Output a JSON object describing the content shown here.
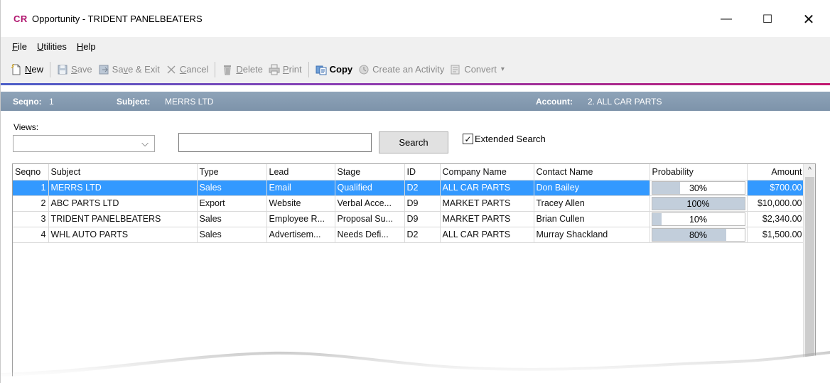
{
  "window": {
    "app_logo": "CR",
    "title": "Opportunity - TRIDENT PANELBEATERS",
    "minimize_glyph": "—",
    "maximize_glyph": "☐",
    "close_glyph": "✕"
  },
  "menu": [
    {
      "u": "F",
      "rest": "ile"
    },
    {
      "u": "U",
      "rest": "tilities"
    },
    {
      "u": "H",
      "rest": "elp"
    }
  ],
  "toolbar": {
    "new": {
      "u": "N",
      "rest": "ew",
      "icon": "new-document-icon"
    },
    "save": {
      "pre": "",
      "u": "S",
      "rest": "ave",
      "icon": "save-icon"
    },
    "save_exit": {
      "pre": "Sa",
      "u": "v",
      "rest": "e & Exit",
      "icon": "save-exit-icon"
    },
    "cancel": {
      "u": "C",
      "rest": "ancel",
      "icon": "cancel-icon"
    },
    "delete": {
      "u": "D",
      "rest": "elete",
      "icon": "trash-icon"
    },
    "print": {
      "u": "P",
      "rest": "rint",
      "icon": "printer-icon"
    },
    "copy": {
      "label": "Copy",
      "icon": "copy-icon"
    },
    "create_activity": {
      "label": "Create an Activity",
      "icon": "activity-icon"
    },
    "convert": {
      "label": "Convert",
      "icon": "convert-icon",
      "dropdown_glyph": "▾"
    }
  },
  "infobar": {
    "seqno_label": "Seqno:",
    "seqno_value": "1",
    "subject_label": "Subject:",
    "subject_value": "MERRS LTD",
    "account_label": "Account:",
    "account_value": "2. ALL CAR PARTS"
  },
  "views": {
    "label": "Views:",
    "selected": "",
    "chevron": "⌵"
  },
  "search": {
    "value": "",
    "button_label": "Search",
    "extended_label": "Extended Search",
    "extended_checked": true,
    "check_glyph": "✓"
  },
  "grid": {
    "columns": [
      "Seqno",
      "Subject",
      "Type",
      "Lead",
      "Stage",
      "ID",
      "Company Name",
      "Contact Name",
      "Probability",
      "Amount"
    ],
    "rows": [
      {
        "seqno": "1",
        "subject": "MERRS LTD",
        "type": "Sales",
        "lead": "Email",
        "stage": "Qualified",
        "id": "D2",
        "company": "ALL CAR PARTS",
        "contact": "Don Bailey",
        "probability": "30%",
        "probability_value": 30,
        "amount": "$700.00",
        "selected": true
      },
      {
        "seqno": "2",
        "subject": "ABC PARTS LTD",
        "type": "Export",
        "lead": "Website",
        "stage": "Verbal Acce...",
        "id": "D9",
        "company": "MARKET PARTS",
        "contact": "Tracey Allen",
        "probability": "100%",
        "probability_value": 100,
        "amount": "$10,000.00",
        "selected": false
      },
      {
        "seqno": "3",
        "subject": "TRIDENT PANELBEATERS",
        "type": "Sales",
        "lead": "Employee R...",
        "stage": "Proposal Su...",
        "id": "D9",
        "company": "MARKET PARTS",
        "contact": "Brian Cullen",
        "probability": "10%",
        "probability_value": 10,
        "amount": "$2,340.00",
        "selected": false
      },
      {
        "seqno": "4",
        "subject": "WHL AUTO PARTS",
        "type": "Sales",
        "lead": "Advertisem...",
        "stage": "Needs Defi...",
        "id": "D2",
        "company": "ALL CAR PARTS",
        "contact": "Murray Shackland",
        "probability": "80%",
        "probability_value": 80,
        "amount": "$1,500.00",
        "selected": false
      }
    ],
    "scroll_up_glyph": "^"
  },
  "colors": {
    "accent": "#b0156e",
    "selection": "#3399ff",
    "infobar": "#8ea3b8",
    "probability_fill": "#c2cedb"
  }
}
